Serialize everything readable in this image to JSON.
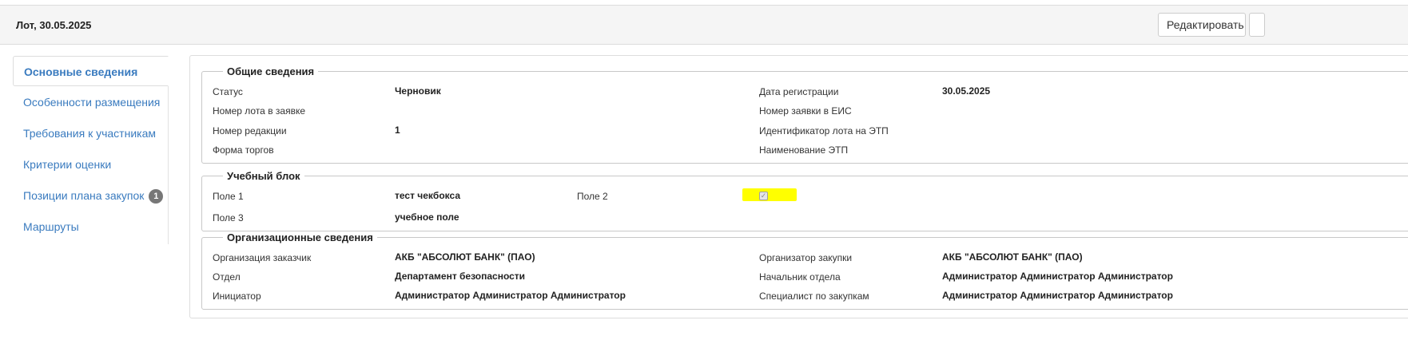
{
  "header": {
    "title": "Лот, 30.05.2025",
    "edit_button": "Редактировать"
  },
  "sidebar": {
    "items": [
      {
        "label": "Основные сведения",
        "active": true
      },
      {
        "label": "Особенности размещения"
      },
      {
        "label": "Требования к участникам"
      },
      {
        "label": "Критерии оценки"
      },
      {
        "label": "Позиции плана закупок",
        "badge": "1"
      },
      {
        "label": "Маршруты"
      }
    ]
  },
  "general": {
    "legend": "Общие сведения",
    "status_label": "Статус",
    "status_value": "Черновик",
    "lot_number_label": "Номер лота в заявке",
    "lot_number_value": "",
    "revision_label": "Номер редакции",
    "revision_value": "1",
    "trade_form_label": "Форма торгов",
    "trade_form_value": "",
    "reg_date_label": "Дата регистрации",
    "reg_date_value": "30.05.2025",
    "eis_number_label": "Номер заявки в ЕИС",
    "eis_number_value": "",
    "etp_lot_id_label": "Идентификатор лота на ЭТП",
    "etp_lot_id_value": "",
    "etp_name_label": "Наименование ЭТП",
    "etp_name_value": ""
  },
  "training": {
    "legend": "Учебный блок",
    "field1_label": "Поле 1",
    "field1_value": "тест чекбокса",
    "field2_label": "Поле 2",
    "field2_checked": true,
    "field3_label": "Поле 3",
    "field3_value": "учебное поле"
  },
  "org": {
    "legend": "Организационные сведения",
    "customer_label": "Организация заказчик",
    "customer_value": "АКБ \"АБСОЛЮТ БАНК\" (ПАО)",
    "department_label": "Отдел",
    "department_value": "Департамент безопасности",
    "initiator_label": "Инициатор",
    "initiator_value": "Администратор Администратор Администратор",
    "organizer_label": "Организатор закупки",
    "organizer_value": "АКБ \"АБСОЛЮТ БАНК\" (ПАО)",
    "dept_head_label": "Начальник отдела",
    "dept_head_value": "Администратор Администратор Администратор",
    "specialist_label": "Специалист по закупкам",
    "specialist_value": "Администратор Администратор Администратор"
  },
  "colors": {
    "link": "#3a7bbf",
    "highlight": "#ffff00",
    "badge": "#777777"
  }
}
